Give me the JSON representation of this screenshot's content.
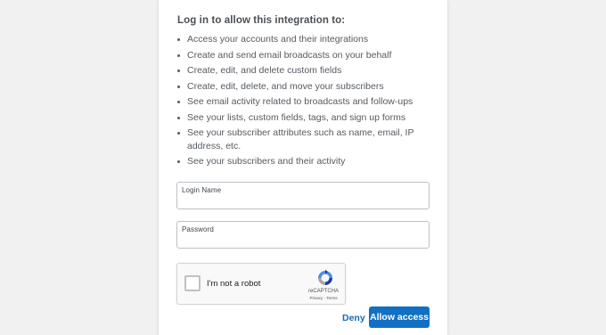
{
  "heading": "Log in to allow this integration to:",
  "permissions": [
    "Access your accounts and their integrations",
    "Create and send email broadcasts on your behalf",
    "Create, edit, and delete custom fields",
    "Create, edit, delete, and move your subscribers",
    "See email activity related to broadcasts and follow-ups",
    "See your lists, custom fields, tags, and sign up forms",
    "See your subscriber attributes such as name, email, IP address, etc.",
    "See your subscribers and their activity"
  ],
  "login_field": {
    "label": "Login Name",
    "value": ""
  },
  "password_field": {
    "label": "Password",
    "value": ""
  },
  "recaptcha": {
    "checkbox_label": "I'm not a robot",
    "brand": "reCAPTCHA",
    "links": "Privacy - Terms"
  },
  "actions": {
    "deny_label": "Deny",
    "allow_label": "Allow access"
  },
  "colors": {
    "accent": "#1170c4",
    "link": "#1a6bb6",
    "text": "#555b61",
    "background": "#f1f1f1"
  },
  "icons": {
    "captcha": "recaptcha-logo-icon"
  }
}
